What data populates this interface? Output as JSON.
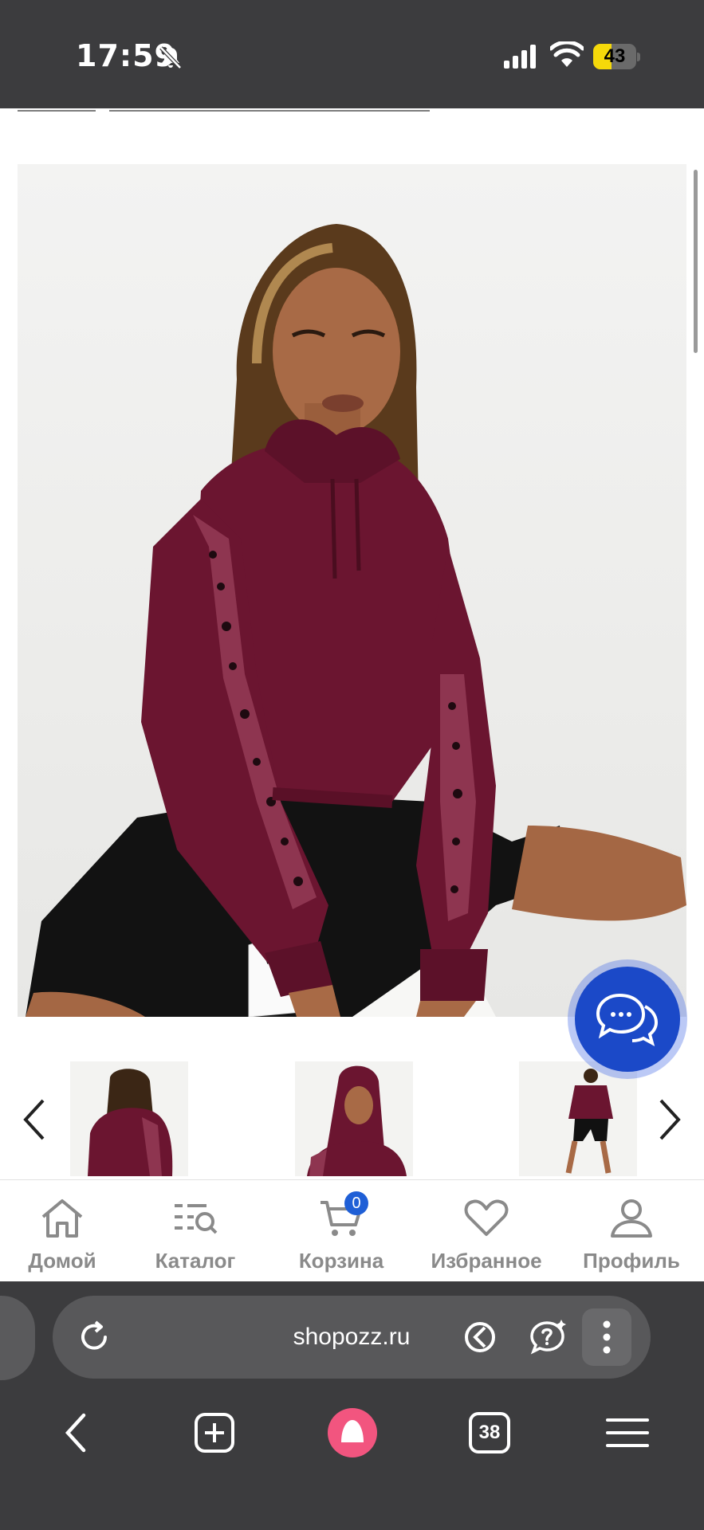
{
  "status_bar": {
    "time": "17:59",
    "battery": "43",
    "battery_level_percent": 43
  },
  "product": {
    "main_image_alt": "Model wearing a burgundy cropped hoodie with leopard-print sleeve stripes and black bike shorts"
  },
  "thumbnails": [
    {
      "alt": "back view"
    },
    {
      "alt": "hood up view"
    },
    {
      "alt": "full body view"
    }
  ],
  "bottom_nav": {
    "items": [
      {
        "label": "Домой",
        "icon": "home-icon"
      },
      {
        "label": "Каталог",
        "icon": "catalog-search-icon"
      },
      {
        "label": "Корзина",
        "icon": "cart-icon"
      },
      {
        "label": "Избранное",
        "icon": "heart-icon"
      },
      {
        "label": "Профиль",
        "icon": "user-icon"
      }
    ],
    "cart_count": "0"
  },
  "browser": {
    "url": "shopozz.ru",
    "tabs_count": "38"
  },
  "colors": {
    "status_bg": "#3c3c3e",
    "accent_blue": "#1b49c8",
    "badge_blue": "#1f5fd6",
    "battery_yellow": "#f5d90a",
    "browser_pink": "#f2557f",
    "hoodie_burgundy": "#6b1530"
  }
}
